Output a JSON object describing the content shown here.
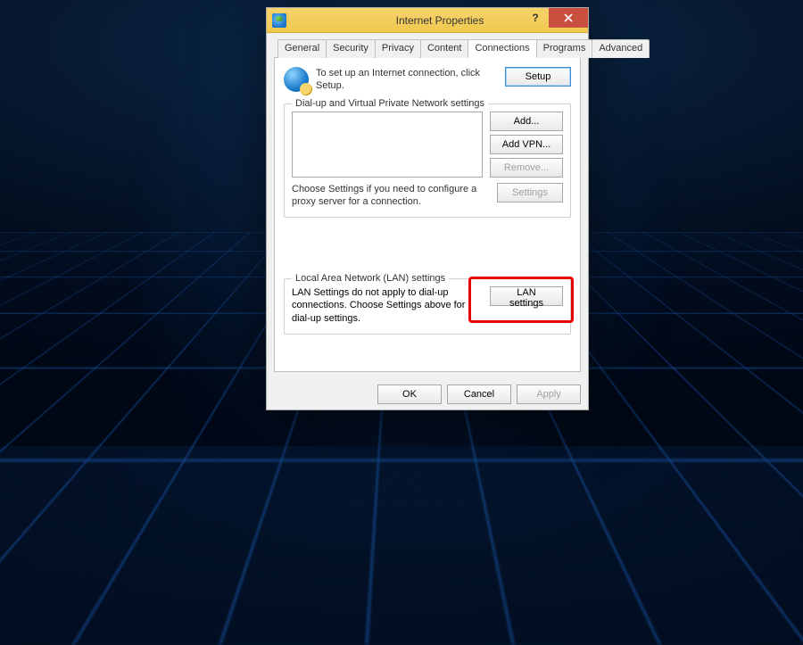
{
  "window": {
    "title": "Internet Properties",
    "help": "?",
    "close": "×"
  },
  "tabs": {
    "items": [
      {
        "label": "General"
      },
      {
        "label": "Security"
      },
      {
        "label": "Privacy"
      },
      {
        "label": "Content"
      },
      {
        "label": "Connections"
      },
      {
        "label": "Programs"
      },
      {
        "label": "Advanced"
      }
    ],
    "active_index": 4
  },
  "setup": {
    "text": "To set up an Internet connection, click Setup.",
    "button": "Setup"
  },
  "dialup": {
    "legend": "Dial-up and Virtual Private Network settings",
    "buttons": {
      "add": "Add...",
      "add_vpn": "Add VPN...",
      "remove": "Remove...",
      "settings": "Settings"
    },
    "hint": "Choose Settings if you need to configure a proxy server for a connection."
  },
  "lan": {
    "legend": "Local Area Network (LAN) settings",
    "text": "LAN Settings do not apply to dial-up connections. Choose Settings above for dial-up settings.",
    "button": "LAN settings"
  },
  "footer": {
    "ok": "OK",
    "cancel": "Cancel",
    "apply": "Apply"
  }
}
